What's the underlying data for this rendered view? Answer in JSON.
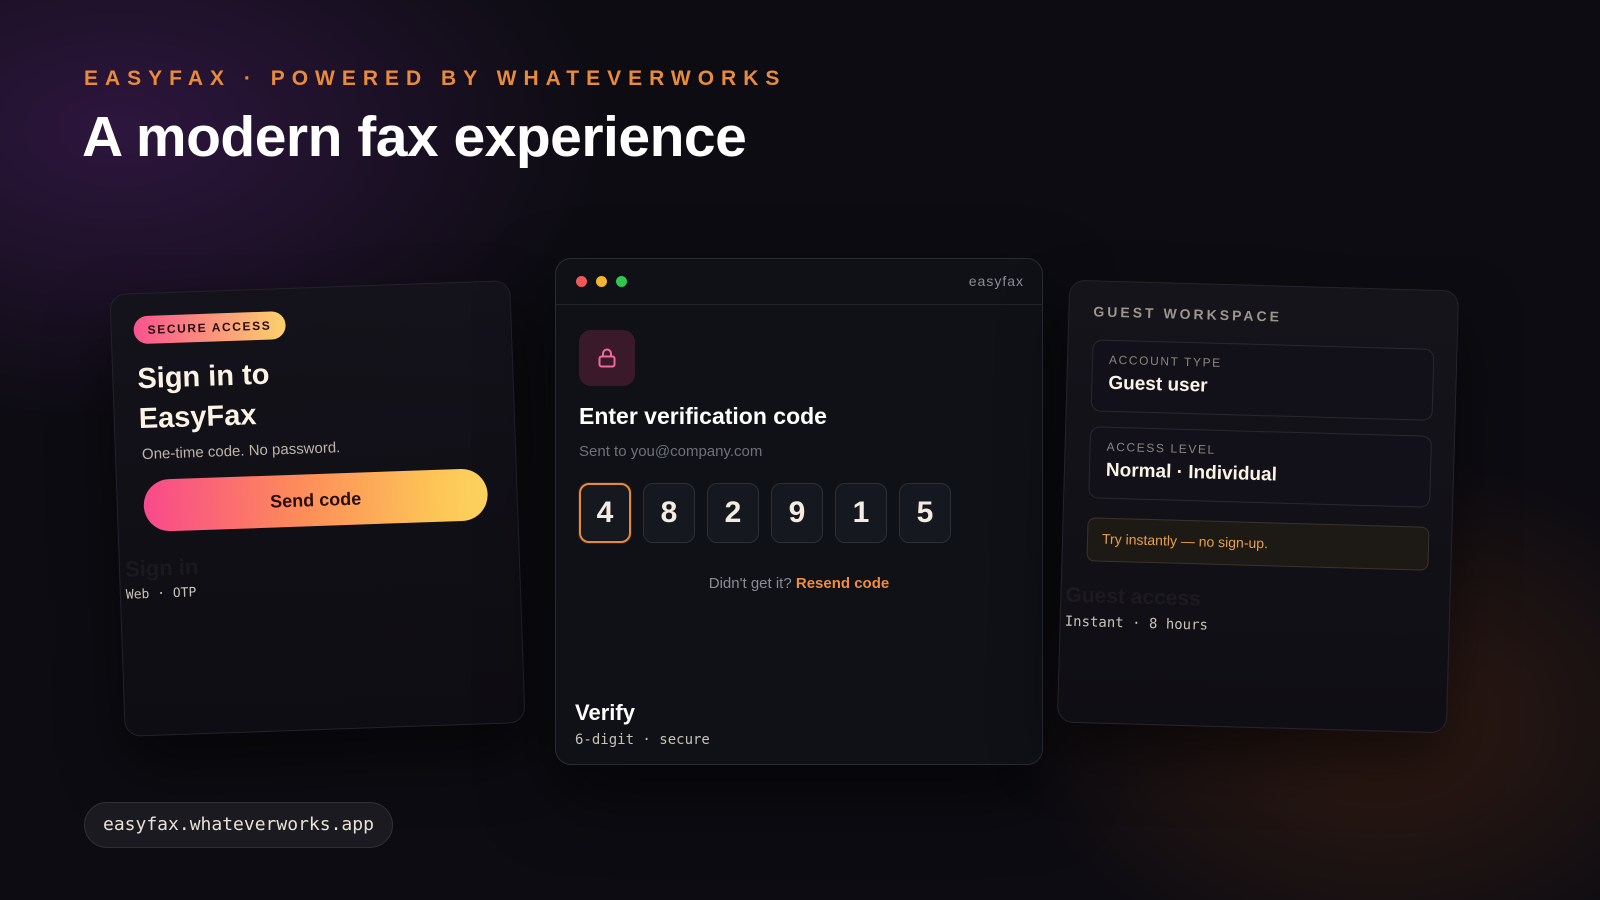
{
  "header": {
    "eyebrow": "EASYFAX · POWERED BY WHATEVERWORKS",
    "headline": "A modern fax experience"
  },
  "signin_card": {
    "badge": "SECURE ACCESS",
    "title": "Sign in to EasyFax",
    "subtitle": "One-time code. No password.",
    "button_label": "Send code",
    "footer_title": "Sign in",
    "footer_meta": "Web · OTP"
  },
  "verify_window": {
    "window_title": "easyfax",
    "icon": "lock-icon",
    "title": "Enter verification code",
    "subtitle": "Sent to you@company.com",
    "digits": [
      "4",
      "8",
      "2",
      "9",
      "1",
      "5"
    ],
    "active_digit_index": 0,
    "resend_prompt": "Didn't get it?",
    "resend_link": "Resend code",
    "footer_title": "Verify",
    "footer_meta": "6-digit · secure"
  },
  "guest_card": {
    "label": "GUEST WORKSPACE",
    "account_type_label": "ACCOUNT TYPE",
    "account_type_value": "Guest user",
    "access_level_label": "ACCESS LEVEL",
    "access_level_value": "Normal · Individual",
    "try_note": "Try instantly — no sign-up.",
    "footer_title": "Guest access",
    "footer_meta": "Instant · 8 hours"
  },
  "url": "easyfax.whateverworks.app",
  "colors": {
    "accent_orange": "#e98b3c",
    "gradient_start": "#f9498c",
    "gradient_end": "#fdd35e",
    "background": "#0d0c12"
  }
}
